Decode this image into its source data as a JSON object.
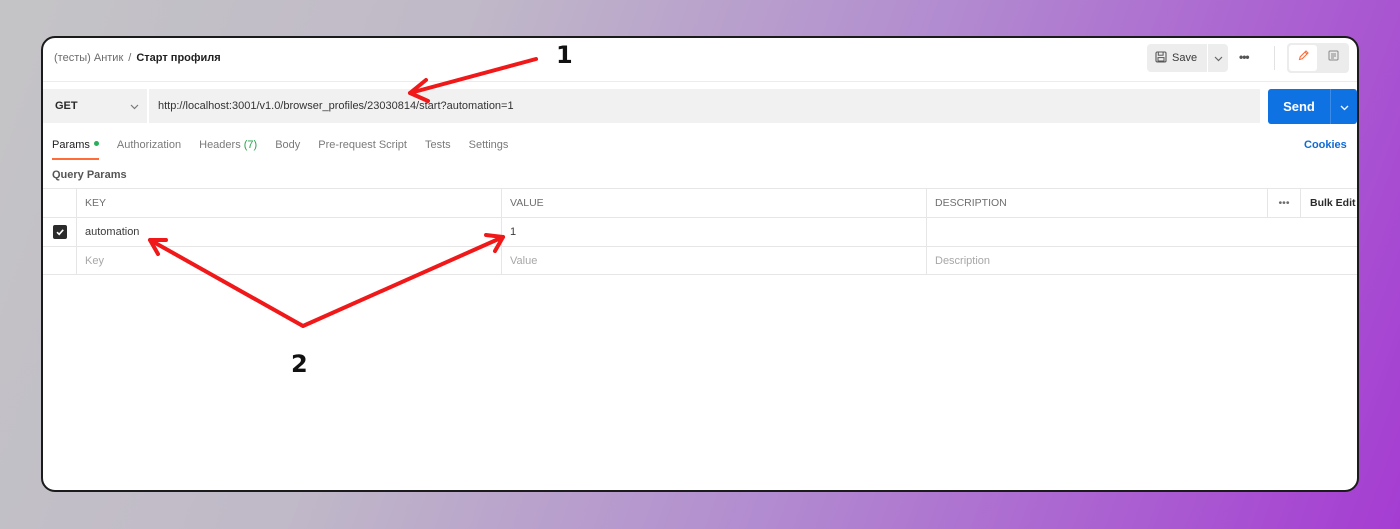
{
  "breadcrumb": {
    "parent": "(тесты) Антик",
    "separator": "/",
    "current": "Старт профиля"
  },
  "toolbar": {
    "save_label": "Save",
    "more": "•••"
  },
  "request": {
    "method": "GET",
    "url": "http://localhost:3001/v1.0/browser_profiles/23030814/start?automation=1",
    "send_label": "Send"
  },
  "tabs": [
    {
      "label": "Params",
      "active": true
    },
    {
      "label": "Authorization"
    },
    {
      "label": "Headers",
      "count": "(7)"
    },
    {
      "label": "Body"
    },
    {
      "label": "Pre-request Script"
    },
    {
      "label": "Tests"
    },
    {
      "label": "Settings"
    }
  ],
  "cookies_label": "Cookies",
  "query_params": {
    "title": "Query Params",
    "headers": {
      "key": "KEY",
      "value": "VALUE",
      "description": "DESCRIPTION",
      "more": "•••",
      "bulk_edit": "Bulk Edit"
    },
    "rows": [
      {
        "key": "automation",
        "value": "1",
        "description": ""
      }
    ],
    "placeholders": {
      "key": "Key",
      "value": "Value",
      "description": "Description"
    }
  },
  "annotations": {
    "label_1": "1",
    "label_2": "2",
    "arrow_color": "#f01818"
  },
  "colors": {
    "accent": "#0f72e3",
    "active_tab": "#ff6c37",
    "params_dot": "#26b05a"
  }
}
